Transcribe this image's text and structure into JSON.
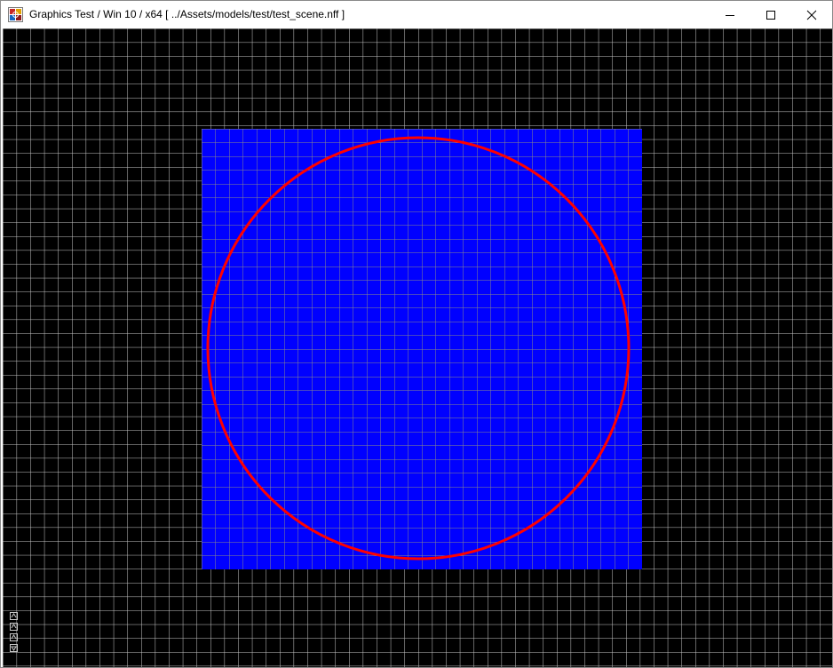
{
  "window": {
    "title": "Graphics Test / Win 10 / x64 [ ../Assets/models/test/test_scene.nff ]",
    "controls": [
      "minimize",
      "maximize",
      "close"
    ]
  },
  "app_icon": "render-app-icon",
  "scene": {
    "background_color": "#000000",
    "grid_color": "#c8c8c8",
    "square_fill": "#0000ff",
    "square_grid_color": "#7f7f7f",
    "circle_stroke": "#ff0000"
  },
  "hud": {
    "icons": [
      "hud-icon-1",
      "hud-icon-2",
      "hud-icon-3",
      "hud-icon-4"
    ]
  }
}
